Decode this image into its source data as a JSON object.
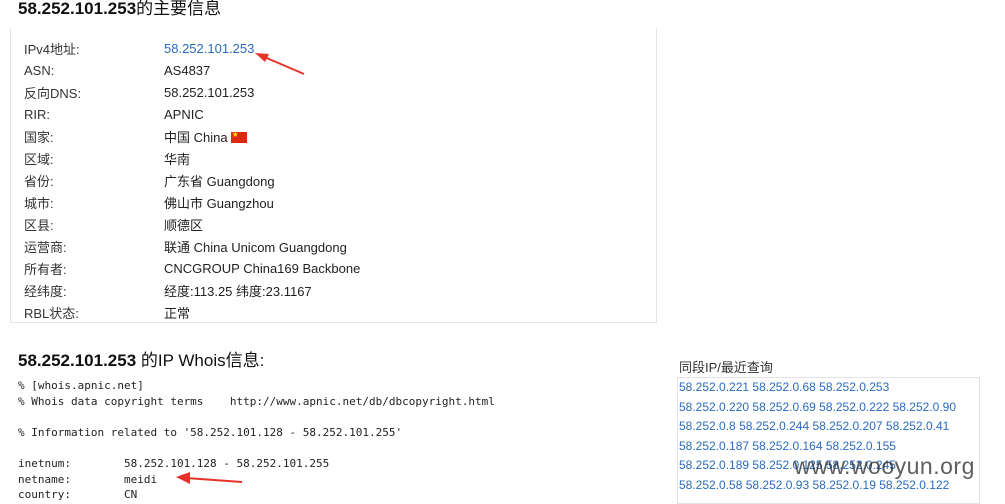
{
  "heading": {
    "ip": "58.252.101.253",
    "suffix": "的主要信息"
  },
  "info_rows": [
    {
      "label": "IPv4地址:",
      "value": "58.252.101.253",
      "link": true
    },
    {
      "label": "ASN:",
      "value": "AS4837"
    },
    {
      "label": "反向DNS:",
      "value": "58.252.101.253"
    },
    {
      "label": "RIR:",
      "value": "APNIC"
    },
    {
      "label": "国家:",
      "value": "中国 China",
      "flag": "china-flag-icon"
    },
    {
      "label": "区域:",
      "value": "华南"
    },
    {
      "label": "省份:",
      "value": "广东省 Guangdong"
    },
    {
      "label": "城市:",
      "value": "佛山市 Guangzhou"
    },
    {
      "label": "区县:",
      "value": "顺德区"
    },
    {
      "label": "运营商:",
      "value": "联通 China Unicom Guangdong"
    },
    {
      "label": "所有者:",
      "value": "CNCGROUP China169 Backbone"
    },
    {
      "label": "经纬度:",
      "value": "经度:113.25 纬度:23.1167"
    },
    {
      "label": "RBL状态:",
      "value": "正常"
    }
  ],
  "whois_heading": {
    "ip": "58.252.101.253",
    "suffix": " 的IP Whois信息:"
  },
  "whois_lines": [
    "% [whois.apnic.net]",
    "% Whois data copyright terms    http://www.apnic.net/db/dbcopyright.html",
    "",
    "% Information related to '58.252.101.128 - 58.252.101.255'",
    "",
    "inetnum:        58.252.101.128 - 58.252.101.255",
    "netname:        meidi",
    "country:        CN"
  ],
  "sidebar": {
    "title": "同段IP/最近查询",
    "rows": [
      [
        "58.252.0.221",
        "58.252.0.68",
        "58.252.0.253"
      ],
      [
        "58.252.0.220",
        "58.252.0.69",
        "58.252.0.222",
        "58.252.0.90"
      ],
      [
        "58.252.0.8",
        "58.252.0.244",
        "58.252.0.207",
        "58.252.0.41"
      ],
      [
        "58.252.0.187",
        "58.252.0.164",
        "58.252.0.155"
      ],
      [
        "58.252.0.189",
        "58.252.0.125",
        "58.252.0.245"
      ],
      [
        "58.252.0.58",
        "58.252.0.93",
        "58.252.0.19",
        "58.252.0.122"
      ]
    ]
  },
  "watermark": "www.wooyun.org",
  "colors": {
    "link": "#2a6bbf",
    "annotation_arrow": "#e5332a",
    "flag_red": "#de2910",
    "flag_star": "#ffde00"
  }
}
